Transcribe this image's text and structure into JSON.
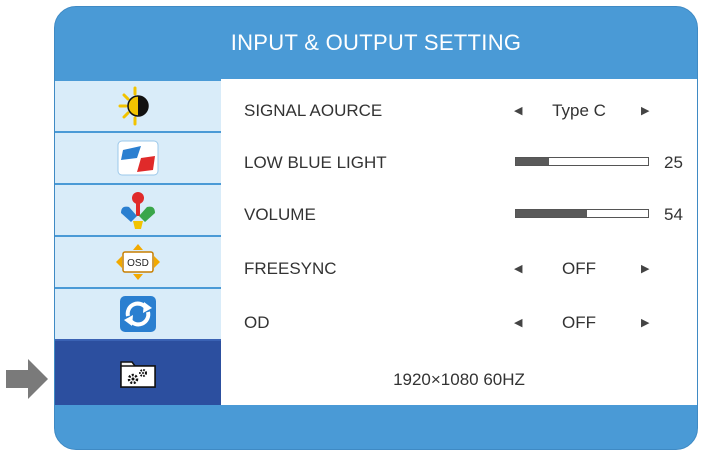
{
  "title": "INPUT & OUTPUT SETTING",
  "sidebar": {
    "items": [
      {
        "icon": "brightness-contrast-icon",
        "active": false
      },
      {
        "icon": "color-swatch-icon",
        "active": false
      },
      {
        "icon": "picture-mode-icon",
        "active": false
      },
      {
        "icon": "osd-icon",
        "osd_text": "OSD",
        "active": false
      },
      {
        "icon": "reset-icon",
        "active": false
      },
      {
        "icon": "settings-folder-icon",
        "active": true
      }
    ]
  },
  "settings": [
    {
      "label": "SIGNAL AOURCE",
      "type": "select",
      "value": "Type C"
    },
    {
      "label": "LOW BLUE LIGHT",
      "type": "slider",
      "value": "25",
      "level": 25
    },
    {
      "label": "VOLUME",
      "type": "slider",
      "value": "54",
      "level": 54
    },
    {
      "label": "FREESYNC",
      "type": "select",
      "value": "OFF"
    },
    {
      "label": "OD",
      "type": "select",
      "value": "OFF"
    }
  ],
  "resolution": "1920×1080 60HZ",
  "colors": {
    "frame": "#4a9ad6",
    "sidebar": "#d9ecf9",
    "sidebar_active": "#2c4f9f",
    "pointer": "#7a7a7a"
  }
}
